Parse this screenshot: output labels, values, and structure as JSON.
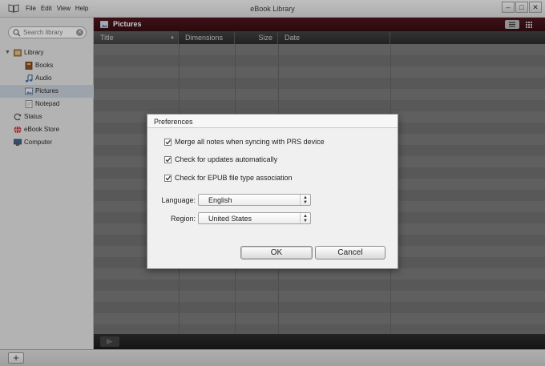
{
  "window": {
    "title": "eBook Library",
    "menu": [
      "File",
      "Edit",
      "View",
      "Help"
    ],
    "controls": {
      "minimize": "–",
      "maximize": "□",
      "close": "✕"
    }
  },
  "sidebar": {
    "search": {
      "placeholder": "Search library",
      "value": ""
    },
    "items": [
      {
        "label": "Library",
        "icon": "library-icon"
      },
      {
        "label": "Books",
        "icon": "book-icon"
      },
      {
        "label": "Audio",
        "icon": "music-note-icon"
      },
      {
        "label": "Pictures",
        "icon": "picture-icon"
      },
      {
        "label": "Notepad",
        "icon": "notepad-icon"
      },
      {
        "label": "Status",
        "icon": "sync-icon"
      },
      {
        "label": "eBook Store",
        "icon": "globe-icon"
      },
      {
        "label": "Computer",
        "icon": "computer-icon"
      }
    ],
    "selected": "Pictures"
  },
  "main": {
    "header_title": "Pictures",
    "columns": [
      "Title",
      "Dimensions",
      "Size",
      "Date"
    ]
  },
  "dialog": {
    "title": "Preferences",
    "checkboxes": [
      {
        "label": "Merge all notes when syncing with PRS device",
        "checked": true
      },
      {
        "label": "Check for updates automatically",
        "checked": true
      },
      {
        "label": "Check for EPUB file type association",
        "checked": true
      }
    ],
    "language": {
      "label": "Language:",
      "value": "English"
    },
    "region": {
      "label": "Region:",
      "value": "United States"
    },
    "ok_label": "OK",
    "cancel_label": "Cancel"
  },
  "statusbar": {
    "add_label": "+"
  },
  "colors": {
    "header_bg": "#3a0710",
    "column_header_bg": "#2e2e2e",
    "row_light": "#747474",
    "row_dark": "#6b6b6b",
    "sidebar_bg": "#e5e5e5",
    "selected_bg": "#c7cfd9"
  }
}
